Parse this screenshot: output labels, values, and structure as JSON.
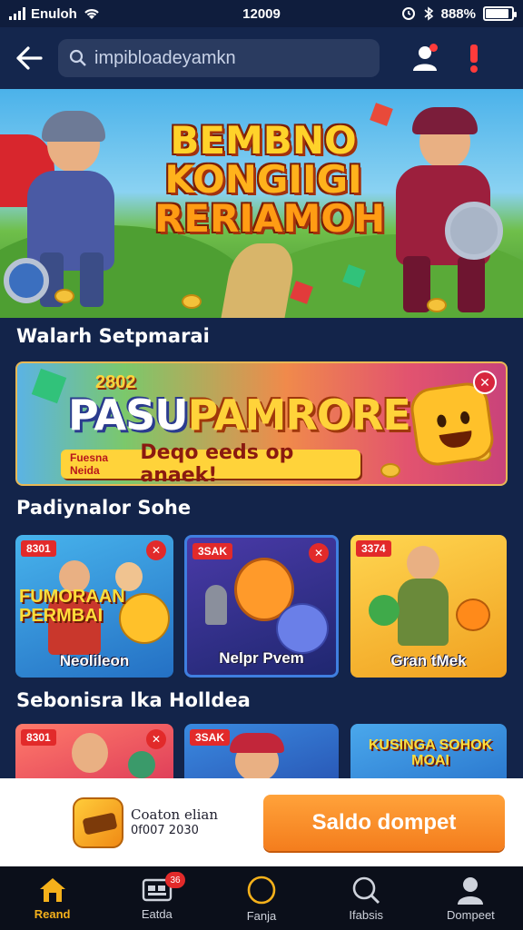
{
  "status_bar": {
    "carrier": "Enuloh",
    "time": "12009",
    "battery": "888%",
    "battery_level": 0.9
  },
  "header": {
    "search_value": "impibloadeyamkn",
    "icons": [
      "back-arrow-icon",
      "search-icon",
      "user-icon",
      "notification-icon"
    ]
  },
  "hero": {
    "title_lines": [
      "BEMBNO",
      "KONGIIGI",
      "RERIAMOH"
    ]
  },
  "sections": {
    "first": "Walarh Setpmarai",
    "second": "Padiynalor Sohe",
    "third": "Sebonisra lka Holldea"
  },
  "promo": {
    "badge": "2802",
    "title_part1": "PASU",
    "title_part2": "PAMRORE",
    "sub_small": "Fuesna Neida",
    "sub_big": "Deqo eeds op anaek!"
  },
  "games": [
    {
      "badge": "8301",
      "title": "FUMORAAN PERMBAI",
      "label": "Neolileon"
    },
    {
      "badge": "3SAK",
      "label": "Nelpr Pvem"
    },
    {
      "badge": "3374",
      "label": "Gran tMek"
    }
  ],
  "games_row2": [
    {
      "badge": "8301"
    },
    {
      "badge": "3SAK"
    },
    {
      "title": "KUSINGA SOHOK MOAI"
    }
  ],
  "wallet": {
    "name": "Coaton elian",
    "date": "0f007 2030",
    "cta": "Saldo dompet"
  },
  "bottom_nav": [
    {
      "label": "Reand",
      "icon": "home-icon",
      "active": true
    },
    {
      "label": "Eatda",
      "icon": "cart-icon",
      "badge": "36"
    },
    {
      "label": "Fanja",
      "icon": "circle-icon"
    },
    {
      "label": "Ifabsis",
      "icon": "search-icon"
    },
    {
      "label": "Dompeet",
      "icon": "profile-icon"
    }
  ],
  "colors": {
    "background": "#13244a",
    "accent": "#f47d1d",
    "active_nav": "#f5b11b",
    "badge": "#e22a2a"
  }
}
